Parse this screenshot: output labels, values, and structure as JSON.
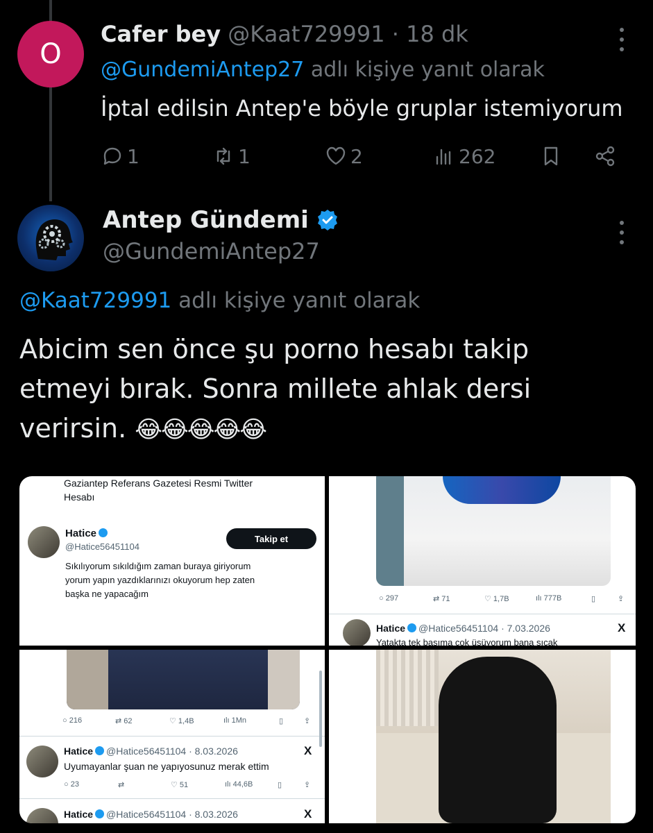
{
  "reply": {
    "avatar_letter": "O",
    "name": "Cafer bey",
    "handle": "@Kaat729991",
    "separator": "·",
    "time": "18 dk",
    "reply_to_handle": "@GundemiAntep27",
    "reply_to_suffix": "adlı kişiye yanıt olarak",
    "text": "İptal edilsin Antep'e böyle gruplar istemiyorum",
    "actions": {
      "replies": "1",
      "reposts": "1",
      "likes": "2",
      "views": "262"
    }
  },
  "tweet": {
    "name": "Antep Gündemi",
    "handle": "@GundemiAntep27",
    "reply_to_handle": "@Kaat729991",
    "reply_to_suffix": "adlı kişiye yanıt olarak",
    "text_line1": "Abicim sen önce şu porno hesabı takip",
    "text_line2": "etmeyi bırak. Sonra millete ahlak dersi",
    "text_line3": "verirsin.",
    "emojis": "😂😂😂😂😂"
  },
  "media": {
    "cell1": {
      "bio": "Gaziantep Referans Gazetesi Resmi Twitter",
      "bio2": "Hesabı",
      "name": "Hatice",
      "handle": "@Hatice56451104",
      "follow_label": "Takip et",
      "post_line1": "Sıkılıyorum sıkıldığım zaman buraya giriyorum",
      "post_line2": "yorum yapın yazdıklarınızı okuyorum hep zaten",
      "post_line3": "başka ne yapacağım"
    },
    "cell2": {
      "replies": "297",
      "reposts": "71",
      "likes": "1,7B",
      "views": "777B",
      "name": "Hatice",
      "handle": "@Hatice56451104",
      "date": "· 7.03.2026",
      "x_logo": "X",
      "post": "Yatakta tek başıma çok üşüyorum bana sıcak"
    },
    "cell3": {
      "replies": "216",
      "reposts": "62",
      "likes": "1,4B",
      "views": "1Mn",
      "name": "Hatice",
      "handle": "@Hatice56451104",
      "date": "· 8.03.2026",
      "x_logo": "X",
      "post": "Uyumayanlar şuan ne yapıyosunuz merak ettim",
      "replies2": "23",
      "likes2": "51",
      "views2": "44,6B",
      "name2": "Hatice",
      "handle2": "@Hatice56451104",
      "date2": "· 8.03.2026",
      "x_logo2": "X"
    }
  },
  "colors": {
    "background": "#000000",
    "link": "#1d9bf0",
    "muted": "#71767b",
    "avatar_o": "#c2185b",
    "verified": "#1d9bf0"
  }
}
